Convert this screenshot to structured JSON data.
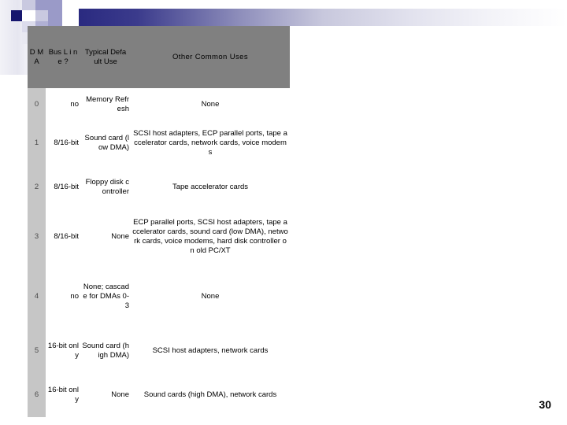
{
  "slide": {
    "page_number": "30",
    "decor": {
      "accent_dark": "#16166e",
      "accent_mid": "#2a2a80",
      "accent_light": "#9a9ac8",
      "accent_pale": "#cfcfe2",
      "header_band": "#808080",
      "row_label_bg": "#c6c6c6"
    }
  },
  "table": {
    "headers": {
      "dma": "D M A",
      "bus_line": "Bus L i n e ?",
      "default_use": "Typical Defa ult Use",
      "other_uses": "Other Common Uses"
    },
    "rows": [
      {
        "dma": "0",
        "bus_line": "no",
        "default_use": "Memory Refresh",
        "other_uses": "None"
      },
      {
        "dma": "1",
        "bus_line": "8/16-bit",
        "default_use": "Sound card (low DMA)",
        "other_uses": "SCSI host adapters, ECP parallel ports, tape accelerator cards, network cards, voice modems"
      },
      {
        "dma": "2",
        "bus_line": "8/16-bit",
        "default_use": "Floppy disk controller",
        "other_uses": "Tape accelerator cards"
      },
      {
        "dma": "3",
        "bus_line": "8/16-bit",
        "default_use": "None",
        "other_uses": "ECP parallel ports, SCSI host adapters, tape accelerator cards, sound card (low DMA), network cards, voice modems, hard disk controller on old PC/XT"
      },
      {
        "dma": "4",
        "bus_line": "no",
        "default_use": "None; cascade for DMAs 0-3",
        "other_uses": "None"
      },
      {
        "dma": "5",
        "bus_line": "16-bit only",
        "default_use": "Sound card (high DMA)",
        "other_uses": "SCSI host adapters, network cards"
      },
      {
        "dma": "6",
        "bus_line": "16-bit only",
        "default_use": "None",
        "other_uses": "Sound cards (high DMA), network cards"
      }
    ]
  }
}
